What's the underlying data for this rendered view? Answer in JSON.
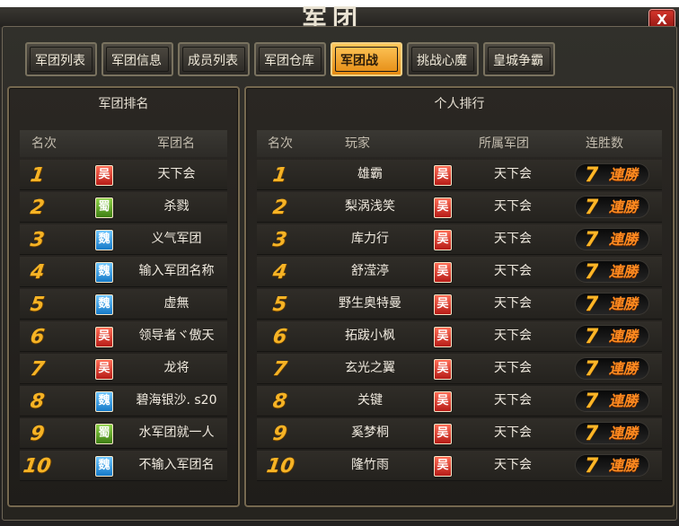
{
  "window": {
    "title": "军团",
    "close_label": "X"
  },
  "tabs": [
    {
      "label": "军团列表",
      "active": false
    },
    {
      "label": "军团信息",
      "active": false
    },
    {
      "label": "成员列表",
      "active": false
    },
    {
      "label": "军团仓库",
      "active": false
    },
    {
      "label": "军团战",
      "active": true
    },
    {
      "label": "挑战心魔",
      "active": false
    },
    {
      "label": "皇城争霸",
      "active": false
    }
  ],
  "guild_ranking": {
    "title": "军团排名",
    "columns": {
      "rank": "名次",
      "name": "军团名"
    },
    "rows": [
      {
        "rank": "1",
        "faction": "吴",
        "faction_color": "red",
        "name": "天下会"
      },
      {
        "rank": "2",
        "faction": "蜀",
        "faction_color": "green",
        "name": "杀戮"
      },
      {
        "rank": "3",
        "faction": "魏",
        "faction_color": "blue",
        "name": "义气军团"
      },
      {
        "rank": "4",
        "faction": "魏",
        "faction_color": "blue",
        "name": "输入军团名称"
      },
      {
        "rank": "5",
        "faction": "魏",
        "faction_color": "blue",
        "name": "虚無"
      },
      {
        "rank": "6",
        "faction": "吴",
        "faction_color": "red",
        "name": "领导者ヾ傲天"
      },
      {
        "rank": "7",
        "faction": "吴",
        "faction_color": "red",
        "name": "龙将"
      },
      {
        "rank": "8",
        "faction": "魏",
        "faction_color": "blue",
        "name": "碧海银沙. s20"
      },
      {
        "rank": "9",
        "faction": "蜀",
        "faction_color": "green",
        "name": "水军团就一人"
      },
      {
        "rank": "10",
        "faction": "魏",
        "faction_color": "blue",
        "name": "不输入军团名"
      }
    ]
  },
  "personal_ranking": {
    "title": "个人排行",
    "columns": {
      "rank": "名次",
      "player": "玩家",
      "guild": "所属军团",
      "streak": "连胜数"
    },
    "streak_suffix": "連勝",
    "rows": [
      {
        "rank": "1",
        "player": "雄霸",
        "faction": "吴",
        "guild": "天下会",
        "streak": "7"
      },
      {
        "rank": "2",
        "player": "梨涡浅笑",
        "faction": "吴",
        "guild": "天下会",
        "streak": "7"
      },
      {
        "rank": "3",
        "player": "库力行",
        "faction": "吴",
        "guild": "天下会",
        "streak": "7"
      },
      {
        "rank": "4",
        "player": "舒滢渟",
        "faction": "吴",
        "guild": "天下会",
        "streak": "7"
      },
      {
        "rank": "5",
        "player": "野生奥特曼",
        "faction": "吴",
        "guild": "天下会",
        "streak": "7"
      },
      {
        "rank": "6",
        "player": "拓跋小枫",
        "faction": "吴",
        "guild": "天下会",
        "streak": "7"
      },
      {
        "rank": "7",
        "player": "玄光之翼",
        "faction": "吴",
        "guild": "天下会",
        "streak": "7"
      },
      {
        "rank": "8",
        "player": "关键",
        "faction": "吴",
        "guild": "天下会",
        "streak": "7"
      },
      {
        "rank": "9",
        "player": "奚梦桐",
        "faction": "吴",
        "guild": "天下会",
        "streak": "7"
      },
      {
        "rank": "10",
        "player": "隆竹雨",
        "faction": "吴",
        "guild": "天下会",
        "streak": "7"
      }
    ]
  },
  "colors": {
    "active_tab": "#f2a526",
    "rank_number": "#f6b325",
    "streak_label": "#ff8a20",
    "faction_wu": "#d9322a",
    "faction_shu": "#6fb230",
    "faction_wei": "#2f9ce6"
  }
}
